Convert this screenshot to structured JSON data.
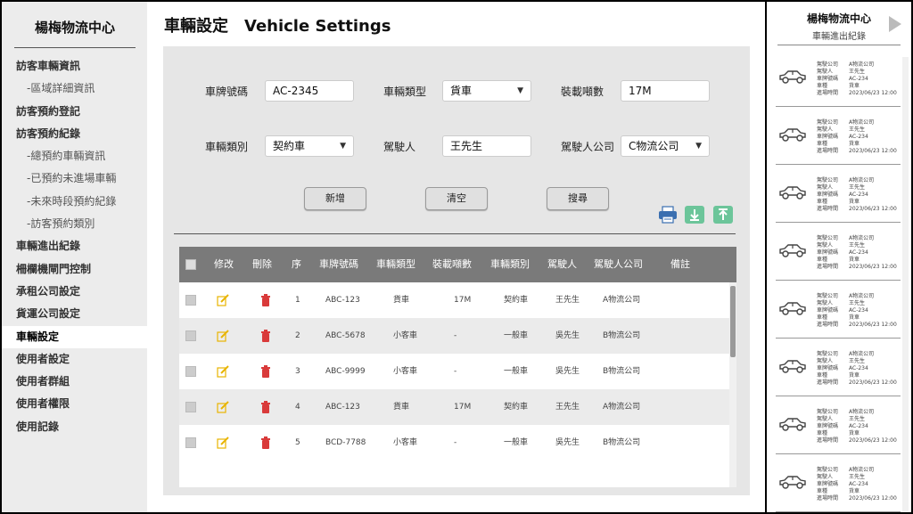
{
  "sidebar": {
    "brand": "楊梅物流中心",
    "items": [
      {
        "label": "訪客車輛資訊",
        "sub": false,
        "active": false
      },
      {
        "label": "-區域詳細資訊",
        "sub": true,
        "active": false
      },
      {
        "label": "訪客預約登記",
        "sub": false,
        "active": false
      },
      {
        "label": "訪客預約紀錄",
        "sub": false,
        "active": false
      },
      {
        "label": "-總預約車輛資訊",
        "sub": true,
        "active": false
      },
      {
        "label": "-已預約未進場車輛",
        "sub": true,
        "active": false
      },
      {
        "label": "-未來時段預約紀錄",
        "sub": true,
        "active": false
      },
      {
        "label": "-訪客預約類別",
        "sub": true,
        "active": false
      },
      {
        "label": "車輛進出紀錄",
        "sub": false,
        "active": false
      },
      {
        "label": "柵欄機閘門控制",
        "sub": false,
        "active": false
      },
      {
        "label": "承租公司設定",
        "sub": false,
        "active": false
      },
      {
        "label": "貨運公司設定",
        "sub": false,
        "active": false
      },
      {
        "label": "車輛設定",
        "sub": false,
        "active": true
      },
      {
        "label": "使用者設定",
        "sub": false,
        "active": false
      },
      {
        "label": "使用者群組",
        "sub": false,
        "active": false
      },
      {
        "label": "使用者權限",
        "sub": false,
        "active": false
      },
      {
        "label": "使用記錄",
        "sub": false,
        "active": false
      }
    ]
  },
  "page": {
    "title_zh": "車輛設定",
    "title_en": "Vehicle Settings"
  },
  "form": {
    "plate_label": "車牌號碼",
    "plate_value": "AC-2345",
    "type_label": "車輛類型",
    "type_value": "貨車",
    "tonnage_label": "裝載噸數",
    "tonnage_value": "17M",
    "category_label": "車輛類別",
    "category_value": "契約車",
    "driver_label": "駕駛人",
    "driver_value": "王先生",
    "company_label": "駕駛人公司",
    "company_value": "C物流公司"
  },
  "buttons": {
    "add": "新增",
    "clear": "清空",
    "search": "搜尋"
  },
  "tools": {
    "print_icon": "printer-icon",
    "download_icon": "download-icon",
    "upload_icon": "upload-icon",
    "accent": "#6cc59a"
  },
  "table": {
    "headers": [
      "修改",
      "刪除",
      "序",
      "車牌號碼",
      "車輛類型",
      "裝載噸數",
      "車輛類別",
      "駕駛人",
      "駕駛人公司",
      "備註"
    ],
    "rows": [
      {
        "seq": "1",
        "plate": "ABC-123",
        "type": "貨車",
        "tonnage": "17M",
        "category": "契約車",
        "driver": "王先生",
        "company": "A物流公司"
      },
      {
        "seq": "2",
        "plate": "ABC-5678",
        "type": "小客車",
        "tonnage": "-",
        "category": "一般車",
        "driver": "吳先生",
        "company": "B物流公司"
      },
      {
        "seq": "3",
        "plate": "ABC-9999",
        "type": "小客車",
        "tonnage": "-",
        "category": "一般車",
        "driver": "吳先生",
        "company": "B物流公司"
      },
      {
        "seq": "4",
        "plate": "ABC-123",
        "type": "貨車",
        "tonnage": "17M",
        "category": "契約車",
        "driver": "王先生",
        "company": "A物流公司"
      },
      {
        "seq": "5",
        "plate": "BCD-7788",
        "type": "小客車",
        "tonnage": "-",
        "category": "一般車",
        "driver": "吳先生",
        "company": "B物流公司"
      }
    ]
  },
  "right_panel": {
    "title": "楊梅物流中心",
    "subtitle": "車輛進出紀錄",
    "card_keys": [
      "駕駛公司",
      "駕駛人",
      "車牌號碼",
      "車種",
      "進場時間"
    ],
    "cards": [
      [
        "A物流公司",
        "王先生",
        "AC-234",
        "貨車",
        "2023/06/23 12:00"
      ],
      [
        "A物流公司",
        "王先生",
        "AC-234",
        "貨車",
        "2023/06/23 12:00"
      ],
      [
        "A物流公司",
        "王先生",
        "AC-234",
        "貨車",
        "2023/06/23 12:00"
      ],
      [
        "A物流公司",
        "王先生",
        "AC-234",
        "貨車",
        "2023/06/23 12:00"
      ],
      [
        "A物流公司",
        "王先生",
        "AC-234",
        "貨車",
        "2023/06/23 12:00"
      ],
      [
        "A物流公司",
        "王先生",
        "AC-234",
        "貨車",
        "2023/06/23 12:00"
      ],
      [
        "A物流公司",
        "王先生",
        "AC-234",
        "貨車",
        "2023/06/23 12:00"
      ],
      [
        "A物流公司",
        "王先生",
        "AC-234",
        "貨車",
        "2023/06/23 12:00"
      ]
    ]
  }
}
